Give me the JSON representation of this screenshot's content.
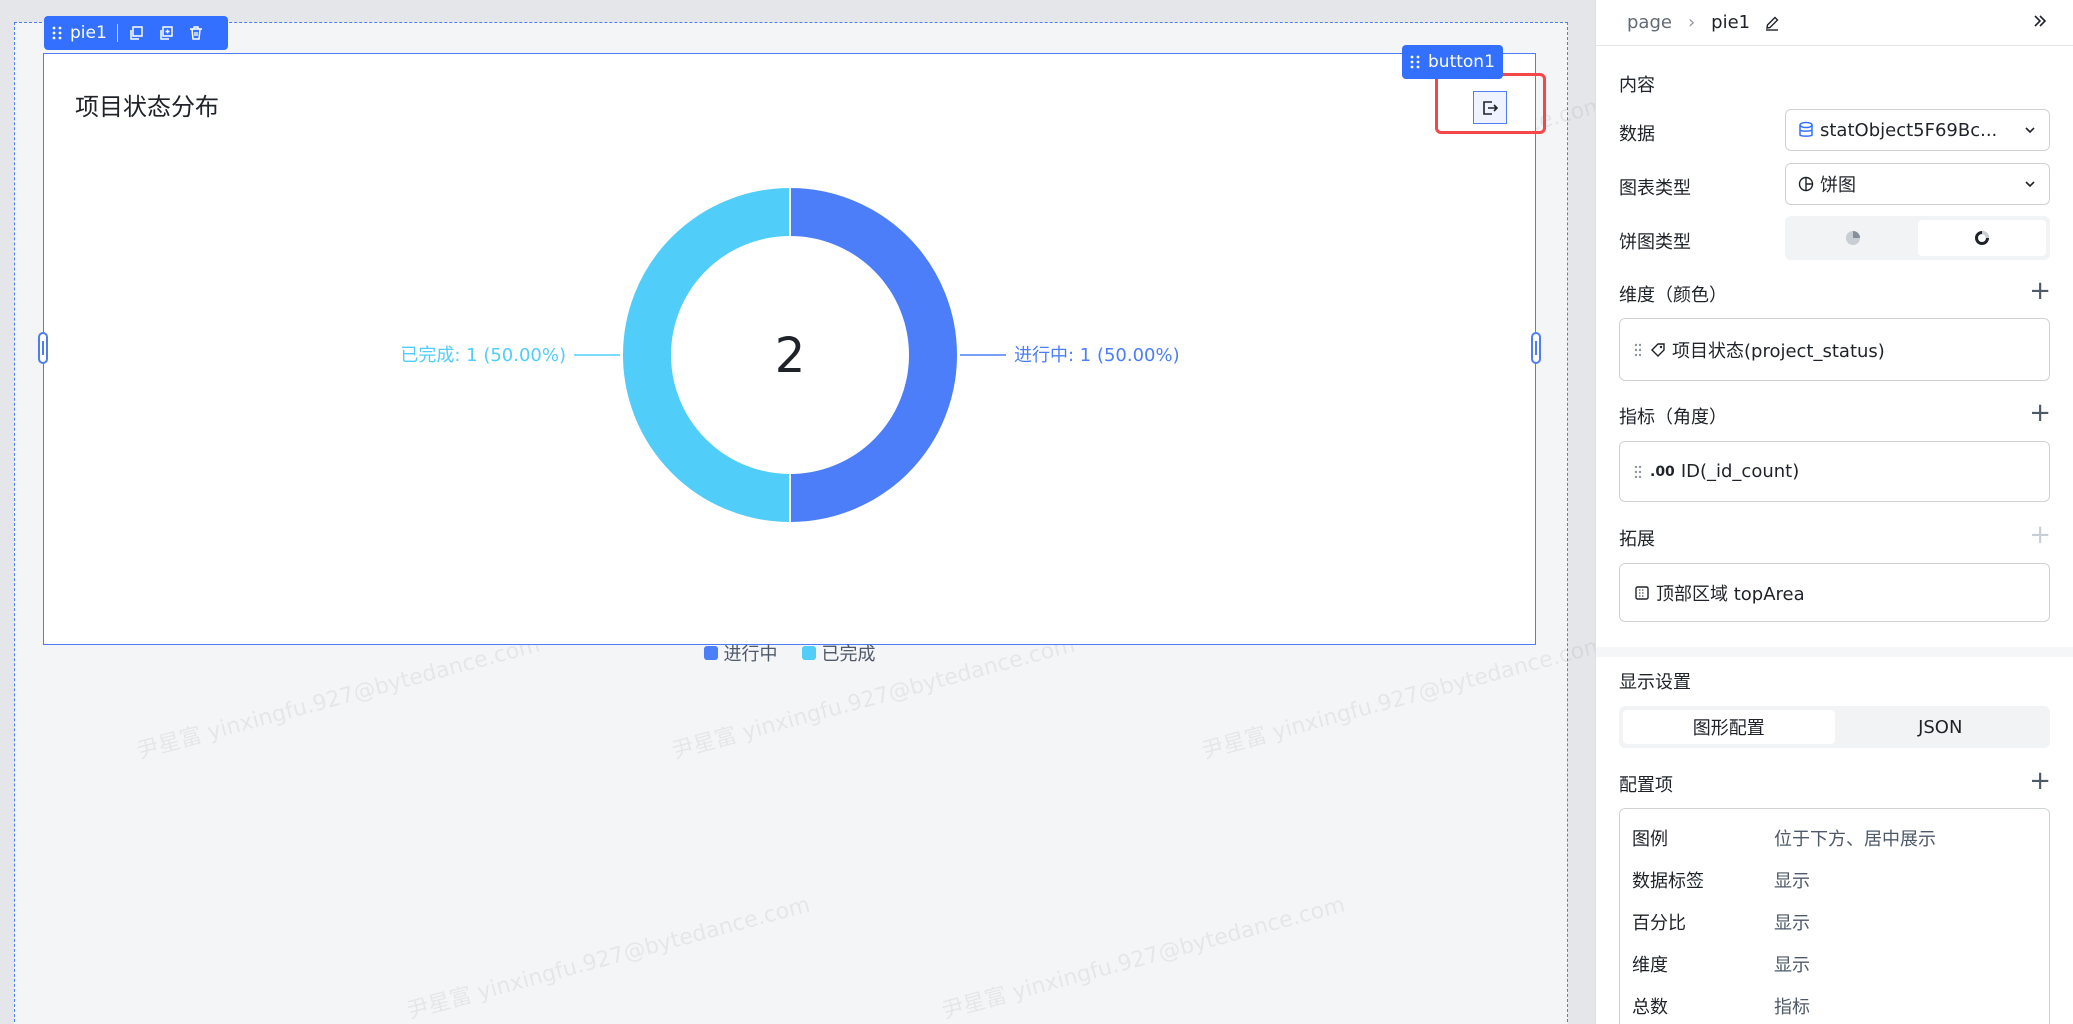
{
  "canvas": {
    "selection_tag": {
      "label": "pie1"
    },
    "button_tag": {
      "label": "button1"
    },
    "card": {
      "title": "项目状态分布",
      "center_total": "2"
    },
    "watermark": "尹星富 yinxingfu.927@bytedance.com"
  },
  "chart_data": {
    "type": "pie",
    "variant": "donut",
    "title": "项目状态分布",
    "categories": [
      "进行中",
      "已完成"
    ],
    "values": [
      1,
      1
    ],
    "percentages": [
      "50.00%",
      "50.00%"
    ],
    "data_labels": [
      "进行中: 1 (50.00%)",
      "已完成: 1 (50.00%)"
    ],
    "colors": [
      "#4b7ef8",
      "#51cdfa"
    ],
    "center_text": "2",
    "legend": {
      "position": "bottom-center",
      "items": [
        "进行中",
        "已完成"
      ]
    }
  },
  "panel": {
    "breadcrumb": {
      "root": "page",
      "current": "pie1"
    },
    "content_section": {
      "title": "内容"
    },
    "data_row": {
      "label": "数据",
      "value": "statObject5F69Bc..."
    },
    "chart_type_row": {
      "label": "图表类型",
      "value": "饼图"
    },
    "pie_type_row": {
      "label": "饼图类型",
      "options": [
        "pie-solid-icon",
        "donut-icon"
      ],
      "selected_index": 1
    },
    "dimension": {
      "title": "维度（颜色）",
      "field": "项目状态(project_status)"
    },
    "metric": {
      "title": "指标（角度）",
      "field_prefix": ".00",
      "field": "ID(_id_count)"
    },
    "extension": {
      "title": "拓展",
      "field": "顶部区域 topArea"
    },
    "display_settings": {
      "title": "显示设置",
      "tabs": [
        "图形配置",
        "JSON"
      ],
      "active_tab": 0
    },
    "config": {
      "title": "配置项",
      "rows": [
        {
          "key": "图例",
          "value": "位于下方、居中展示"
        },
        {
          "key": "数据标签",
          "value": "显示"
        },
        {
          "key": "百分比",
          "value": "显示"
        },
        {
          "key": "维度",
          "value": "显示"
        },
        {
          "key": "总数",
          "value": "指标"
        }
      ]
    }
  }
}
